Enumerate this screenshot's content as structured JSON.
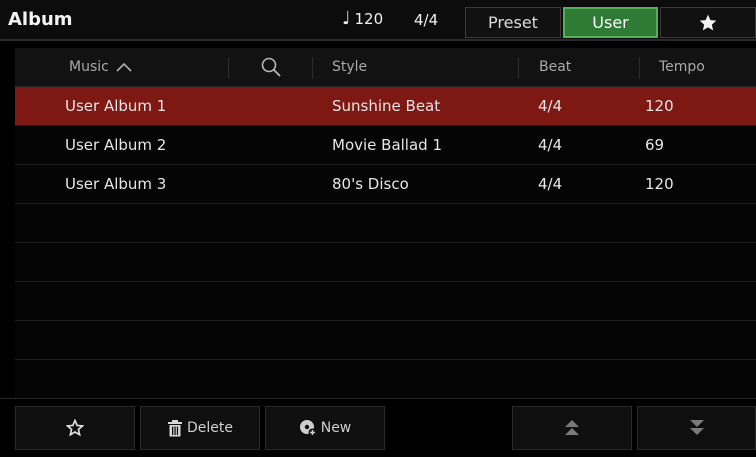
{
  "header": {
    "title": "Album",
    "tempo": "120",
    "time_signature": "4/4",
    "tabs": [
      {
        "label": "Preset",
        "active": false
      },
      {
        "label": "User",
        "active": true
      },
      {
        "label": "",
        "icon": "star-icon",
        "active": false
      }
    ]
  },
  "table": {
    "columns": {
      "music": "Music",
      "style": "Style",
      "beat": "Beat",
      "tempo": "Tempo"
    },
    "sort": {
      "column": "music",
      "direction": "ascending"
    },
    "rows": [
      {
        "music": "User Album 1",
        "style": "Sunshine Beat",
        "beat": "4/4",
        "tempo": "120",
        "selected": true
      },
      {
        "music": "User Album 2",
        "style": "Movie Ballad 1",
        "beat": "4/4",
        "tempo": "69",
        "selected": false
      },
      {
        "music": "User Album 3",
        "style": "80's Disco",
        "beat": "4/4",
        "tempo": "120",
        "selected": false
      }
    ],
    "empty_rows": 5
  },
  "toolbar": {
    "favorite_icon": "star-outline-icon",
    "delete_label": "Delete",
    "delete_icon": "trash-icon",
    "new_label": "New",
    "new_icon": "new-album-icon",
    "page_up_icon": "double-chevron-up-icon",
    "page_down_icon": "double-chevron-down-icon"
  },
  "colors": {
    "selected_row": "#7e1812",
    "active_tab": "#2f7a35",
    "active_tab_border": "#55b05a",
    "background": "#000000"
  }
}
